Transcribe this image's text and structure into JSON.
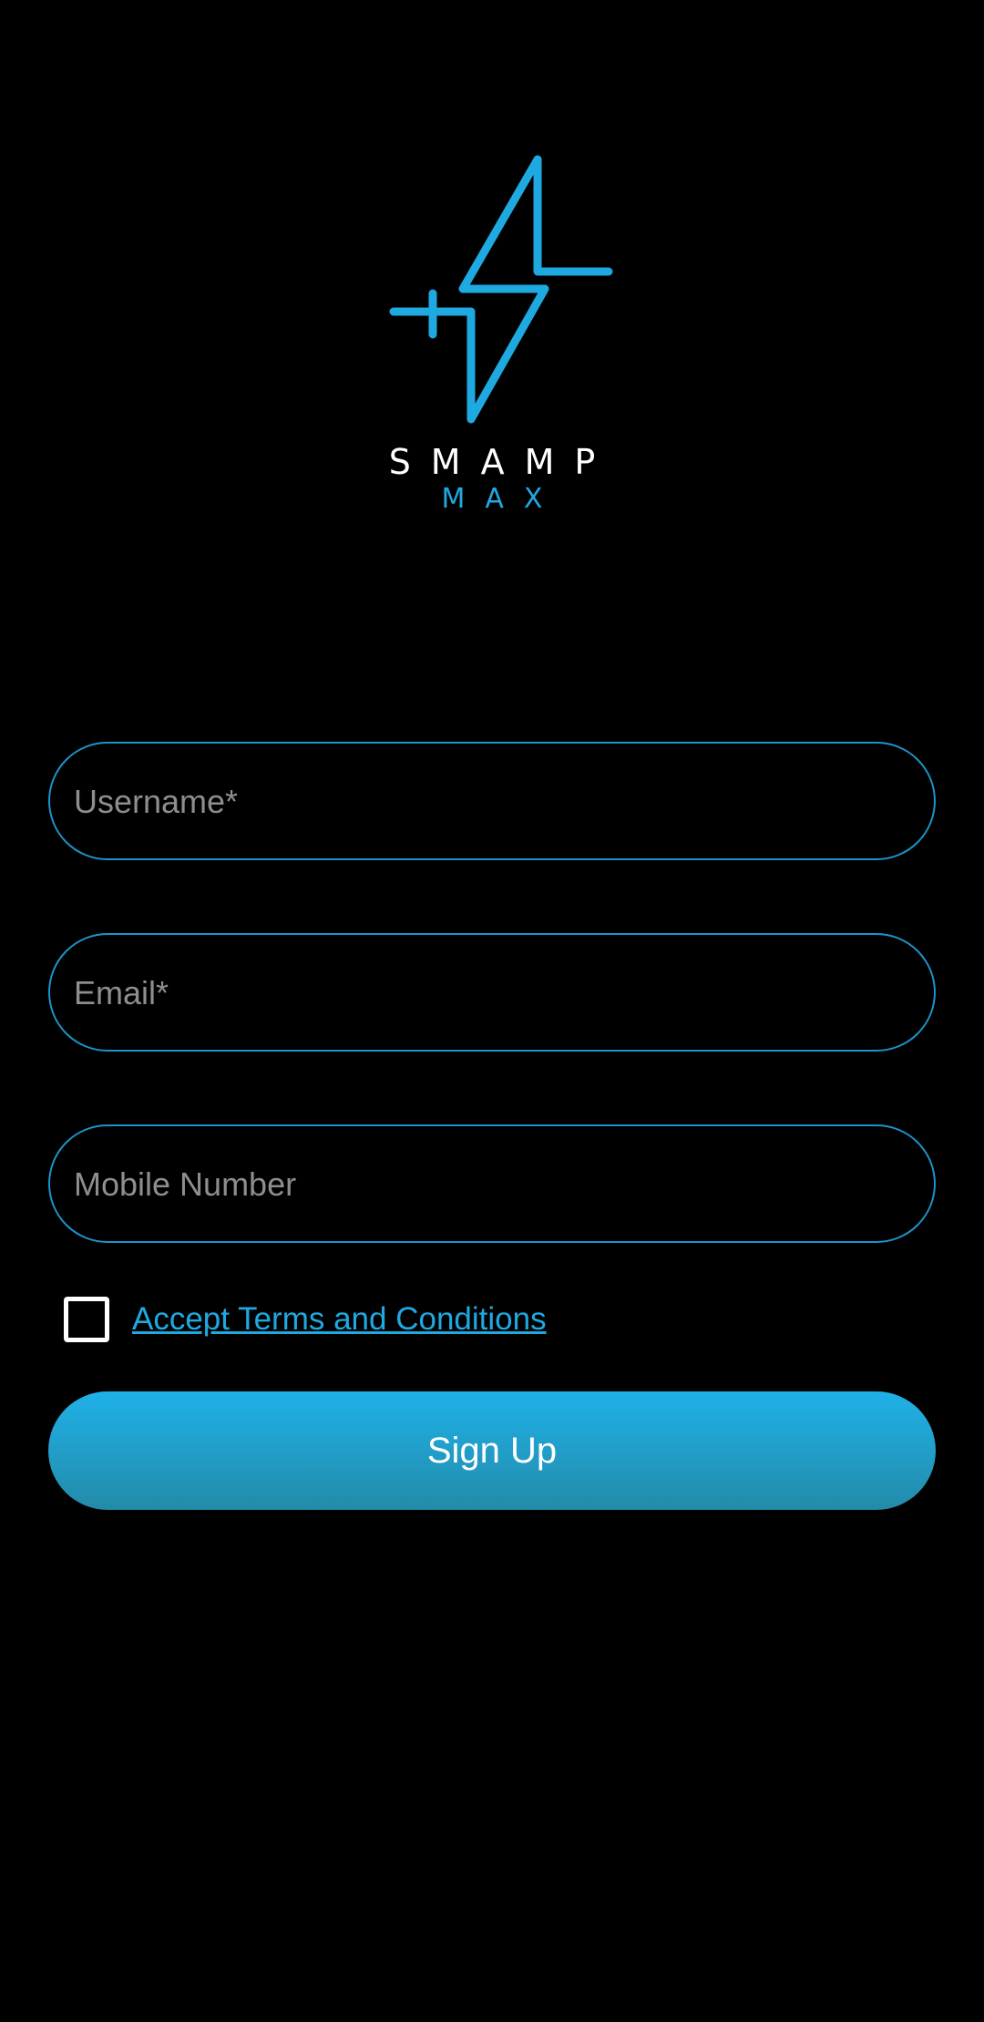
{
  "brand": {
    "name": "SMAMP",
    "sub": "MAX",
    "accent_color": "#1fa9e1",
    "logo_icon": "bolt-plus-logo-icon"
  },
  "form": {
    "username_placeholder": "Username*",
    "email_placeholder": "Email*",
    "mobile_placeholder": "Mobile Number",
    "terms_label": "Accept Terms and Conditions",
    "terms_checked": false,
    "signup_label": "Sign Up"
  },
  "colors": {
    "background": "#000000",
    "field_border": "#1c94c9",
    "button_gradient_top": "#1fb1e8",
    "button_gradient_bottom": "#238ba9"
  }
}
